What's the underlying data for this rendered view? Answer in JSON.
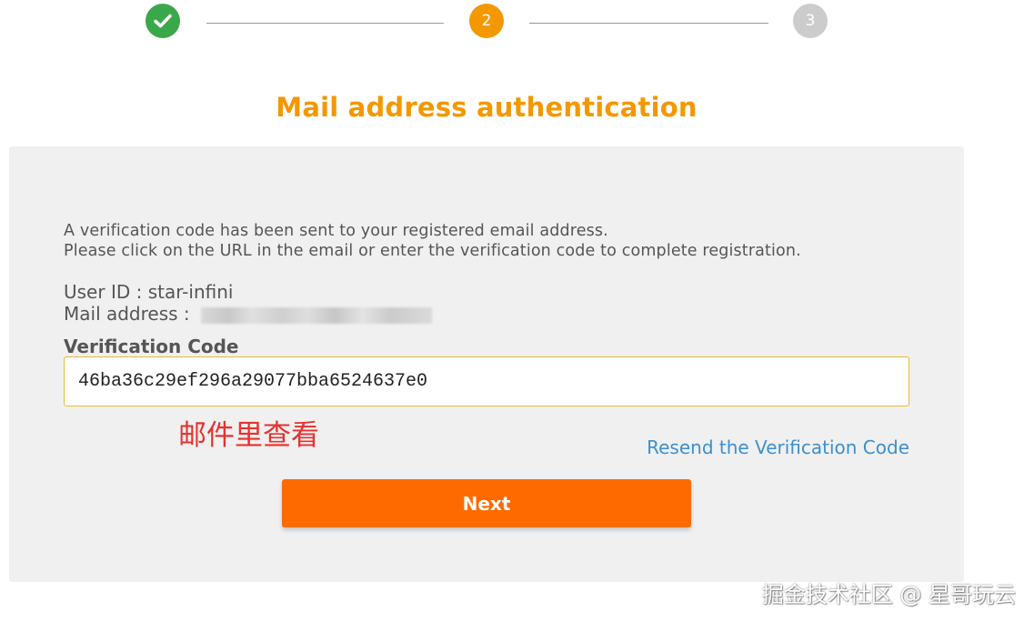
{
  "stepper": {
    "step2_label": "2",
    "step3_label": "3"
  },
  "title": "Mail address authentication",
  "message": {
    "line1": "A verification code has been sent to your registered email address.",
    "line2": "Please click on the URL in the email or enter the verification code to complete registration."
  },
  "account": {
    "user_id_label": "User ID : ",
    "user_id_value": "star-infini",
    "mail_label": "Mail address : "
  },
  "verification": {
    "label": "Verification Code",
    "value": "46ba36c29ef296a29077bba6524637e0"
  },
  "annotation": "邮件里查看",
  "resend_link": "Resend the Verification Code",
  "next_button": "Next",
  "watermark": "掘金技术社区 @ 星哥玩云",
  "colors": {
    "accent_orange": "#f39800",
    "button_orange": "#ff6a00",
    "step_done_green": "#3aa84a",
    "step_pending_gray": "#cccccc",
    "link_blue": "#3d8fd1",
    "annotation_red": "#e8312f"
  }
}
